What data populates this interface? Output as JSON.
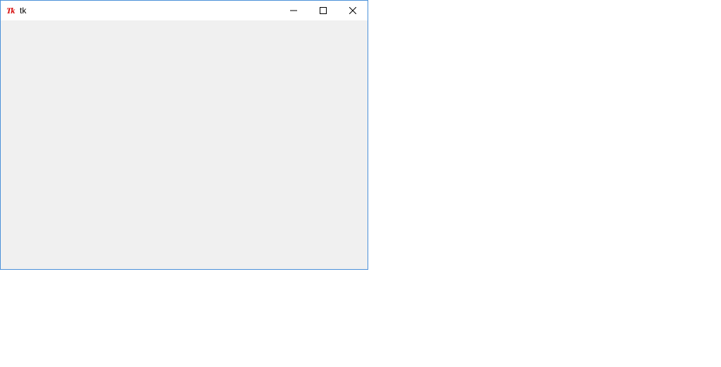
{
  "window": {
    "title": "tk",
    "icon": "tk-feather-icon",
    "icon_text": "Tk",
    "border_color": "#4a90d9",
    "client_background": "#f0f0f0",
    "controls": [
      {
        "name": "minimize",
        "icon": "minimize-icon"
      },
      {
        "name": "maximize",
        "icon": "maximize-icon"
      },
      {
        "name": "close",
        "icon": "close-icon"
      }
    ]
  }
}
